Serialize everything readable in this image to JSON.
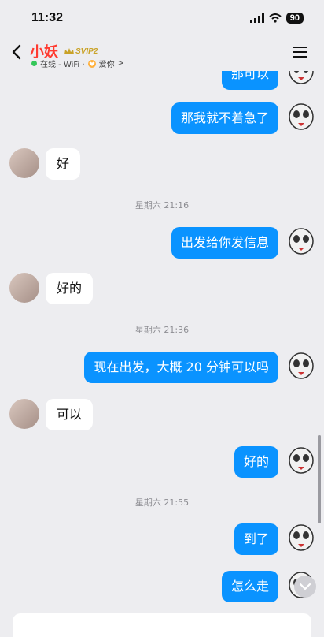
{
  "status": {
    "time": "11:32",
    "battery": "90"
  },
  "header": {
    "name": "小妖",
    "vip": "SVIP2",
    "presence": "在线 - WiFi ·",
    "relation": "爱你",
    "chevron": ">"
  },
  "messages": {
    "m0": "那可以",
    "m1": "那我就不着急了",
    "m2": "好",
    "t1": "星期六 21:16",
    "m3": "出发给你发信息",
    "m4": "好的",
    "t2": "星期六 21:36",
    "m5": "现在出发，大概 20 分钟可以吗",
    "m6": "可以",
    "m7": "好的",
    "t3": "星期六 21:55",
    "m8": "到了",
    "m9": "怎么走"
  },
  "colors": {
    "accent": "#0a93ff",
    "name": "#ff3b30",
    "online": "#34c759",
    "background": "#ededf0"
  },
  "icons": [
    "back-arrow-icon",
    "menu-icon",
    "signal-icon",
    "wifi-icon",
    "battery-icon",
    "scroll-down-icon"
  ]
}
